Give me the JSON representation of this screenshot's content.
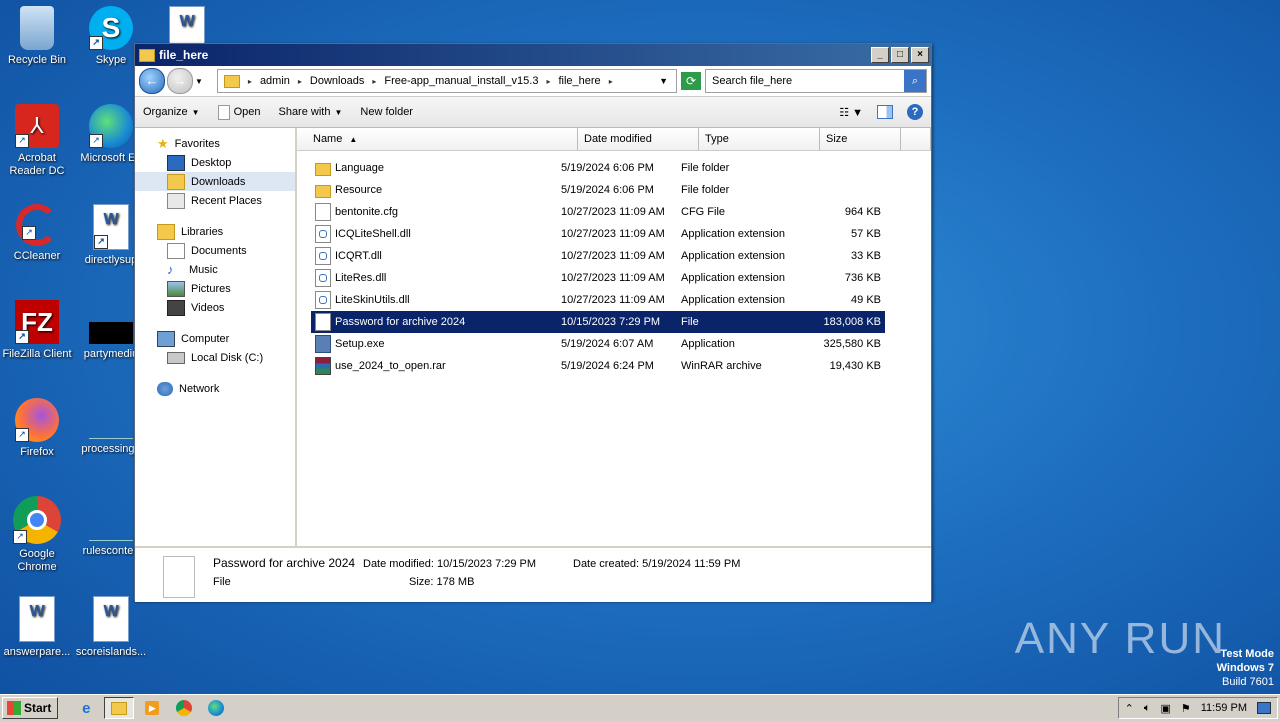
{
  "desktop": {
    "icons": [
      {
        "label": "Recycle Bin",
        "icon": "recycle-bin-icon"
      },
      {
        "label": "Skype",
        "icon": "skype-icon"
      },
      {
        "label": "Acrobat Reader DC",
        "icon": "acrobat-icon"
      },
      {
        "label": "Microsoft Ed",
        "icon": "edge-icon"
      },
      {
        "label": "CCleaner",
        "icon": "ccleaner-icon"
      },
      {
        "label": "directlysup",
        "icon": "word-doc-icon"
      },
      {
        "label": "FileZilla Client",
        "icon": "filezilla-icon"
      },
      {
        "label": "partymediu",
        "icon": "black-file-icon"
      },
      {
        "label": "Firefox",
        "icon": "firefox-icon"
      },
      {
        "label": "processingo",
        "icon": "blank-file-icon"
      },
      {
        "label": "Google Chrome",
        "icon": "chrome-icon"
      },
      {
        "label": "rulesconten",
        "icon": "blank-file-icon"
      },
      {
        "label": "answerpare...",
        "icon": "word-doc-icon"
      },
      {
        "label": "scoreislands...",
        "icon": "word-doc-icon"
      }
    ]
  },
  "window": {
    "title": "file_here",
    "breadcrumbs": [
      "admin",
      "Downloads",
      "Free-app_manual_install_v15.3",
      "file_here"
    ],
    "search_placeholder": "Search file_here",
    "toolbar": {
      "organize": "Organize",
      "open": "Open",
      "share_with": "Share with",
      "new_folder": "New folder"
    },
    "nav": {
      "favorites": "Favorites",
      "desktop": "Desktop",
      "downloads": "Downloads",
      "recent_places": "Recent Places",
      "libraries": "Libraries",
      "documents": "Documents",
      "music": "Music",
      "pictures": "Pictures",
      "videos": "Videos",
      "computer": "Computer",
      "local_disk": "Local Disk (C:)",
      "network": "Network"
    },
    "columns": {
      "name": "Name",
      "date": "Date modified",
      "type": "Type",
      "size": "Size"
    },
    "files": [
      {
        "name": "Language",
        "date": "5/19/2024 6:06 PM",
        "type": "File folder",
        "size": "",
        "icon": "folder"
      },
      {
        "name": "Resource",
        "date": "5/19/2024 6:06 PM",
        "type": "File folder",
        "size": "",
        "icon": "folder"
      },
      {
        "name": "bentonite.cfg",
        "date": "10/27/2023 11:09 AM",
        "type": "CFG File",
        "size": "964 KB",
        "icon": "file"
      },
      {
        "name": "ICQLiteShell.dll",
        "date": "10/27/2023 11:09 AM",
        "type": "Application extension",
        "size": "57 KB",
        "icon": "dll"
      },
      {
        "name": "ICQRT.dll",
        "date": "10/27/2023 11:09 AM",
        "type": "Application extension",
        "size": "33 KB",
        "icon": "dll"
      },
      {
        "name": "LiteRes.dll",
        "date": "10/27/2023 11:09 AM",
        "type": "Application extension",
        "size": "736 KB",
        "icon": "dll"
      },
      {
        "name": "LiteSkinUtils.dll",
        "date": "10/27/2023 11:09 AM",
        "type": "Application extension",
        "size": "49 KB",
        "icon": "dll"
      },
      {
        "name": "Password for archive 2024",
        "date": "10/15/2023 7:29 PM",
        "type": "File",
        "size": "183,008 KB",
        "icon": "file",
        "selected": true
      },
      {
        "name": "Setup.exe",
        "date": "5/19/2024 6:07 AM",
        "type": "Application",
        "size": "325,580 KB",
        "icon": "exe"
      },
      {
        "name": "use_2024_to_open.rar",
        "date": "5/19/2024 6:24 PM",
        "type": "WinRAR archive",
        "size": "19,430 KB",
        "icon": "rar"
      }
    ],
    "details": {
      "name": "Password for archive 2024",
      "type": "File",
      "modified": "Date modified: 10/15/2023 7:29 PM",
      "size": "Size: 178 MB",
      "created": "Date created: 5/19/2024 11:59 PM"
    }
  },
  "taskbar": {
    "start": "Start",
    "clock": "11:59 PM"
  },
  "watermark": "ANY RUN",
  "test_mode": {
    "line1": "Test Mode",
    "line2": "Windows 7",
    "line3": "Build 7601"
  }
}
